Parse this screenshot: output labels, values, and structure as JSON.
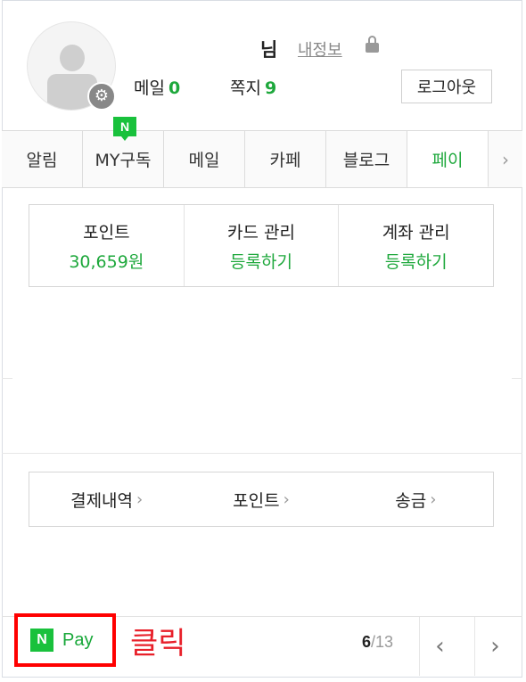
{
  "profile": {
    "username": "님",
    "myinfo_label": "내정보",
    "mail_label": "메일",
    "mail_count": "0",
    "note_label": "쪽지",
    "note_count": "9",
    "logout_label": "로그아웃"
  },
  "tabs": {
    "badge": "N",
    "items": [
      {
        "label": "알림"
      },
      {
        "label": "MY구독"
      },
      {
        "label": "메일"
      },
      {
        "label": "카페"
      },
      {
        "label": "블로그"
      },
      {
        "label": "페이"
      }
    ],
    "next_arrow": "›"
  },
  "pay_info": [
    {
      "label": "포인트",
      "value": "30,659원"
    },
    {
      "label": "카드 관리",
      "value": "등록하기"
    },
    {
      "label": "계좌 관리",
      "value": "등록하기"
    }
  ],
  "links": [
    {
      "label": "결제내역",
      "chevron": "›"
    },
    {
      "label": "포인트",
      "chevron": "›"
    },
    {
      "label": "송금",
      "chevron": "›"
    }
  ],
  "footer": {
    "npay_logo": "N",
    "npay_text": "Pay",
    "annotation": "클릭",
    "page_current": "6",
    "page_total": "/13",
    "prev": "‹",
    "next": "›"
  },
  "colors": {
    "accent_green": "#1ea83c",
    "annotation_red": "#ff0000"
  }
}
